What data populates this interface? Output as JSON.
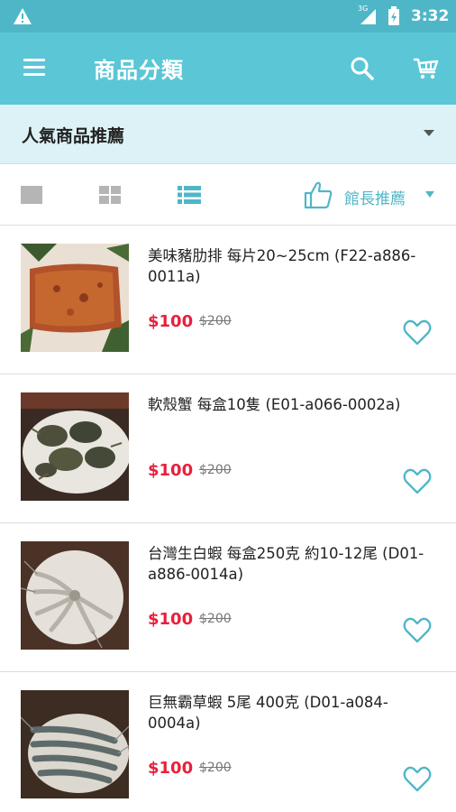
{
  "status_bar": {
    "network": "3G",
    "time": "3:32"
  },
  "app_bar": {
    "title": "商品分類"
  },
  "category": {
    "selected": "人氣商品推薦"
  },
  "toolbar": {
    "sort_label": "館長推薦"
  },
  "products": [
    {
      "name": "美味豬肋排 每片20~25cm (F22-a886-0011a)",
      "price": "$100",
      "old_price": "$200"
    },
    {
      "name": "軟殼蟹 每盒10隻 (E01-a066-0002a)",
      "price": "$100",
      "old_price": "$200"
    },
    {
      "name": "台灣生白蝦 每盒250克 約10-12尾 (D01-a886-0014a)",
      "price": "$100",
      "old_price": "$200"
    },
    {
      "name": "巨無霸草蝦 5尾 400克 (D01-a084-0004a)",
      "price": "$100",
      "old_price": "$200"
    }
  ],
  "colors": {
    "primary": "#5bc6d6",
    "status_bar": "#4fb6c8",
    "category_bg": "#ddf2f7",
    "price": "#e8203c",
    "accent": "#4fb6c8"
  }
}
